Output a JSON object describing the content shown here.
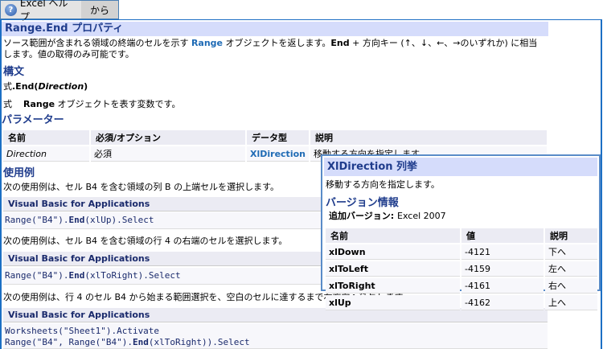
{
  "toolbar": {
    "help_label": "Excel ヘルプ",
    "from_label": "から"
  },
  "title": "Range.End プロパティ",
  "desc": {
    "l1a": "ソース範囲が含まれる領域の終端のセルを示す ",
    "l1link": "Range",
    "l1b": " オブジェクトを返します。",
    "l1bold": "End",
    "l1c": " + 方向キー (↑、↓、←、→のいずれか) に相当",
    "l2": "します。値の取得のみ可能です。"
  },
  "syntax": {
    "heading": "構文",
    "expr_prefix": "式",
    "expr_main": ".End(",
    "expr_param": "Direction",
    "expr_close": ")",
    "expr_label": "式",
    "expr_obj": "Range",
    "expr_desc": " オブジェクトを表す変数です。"
  },
  "params": {
    "heading": "パラメーター",
    "headers": [
      "名前",
      "必須/オプション",
      "データ型",
      "説明"
    ],
    "rows": [
      {
        "name": "Direction",
        "req": "必須",
        "type": "XlDirection",
        "desc": "移動する方向を指定します。"
      }
    ]
  },
  "examples": {
    "heading": "使用例",
    "items": [
      {
        "text": "次の使用例は、セル B4 を含む領域の列 B の上端セルを選択します。",
        "lang": "Visual Basic for Applications",
        "code": [
          [
            "Range(\"B4\").",
            "End",
            "(xlUp).Select"
          ]
        ]
      },
      {
        "text": "次の使用例は、セル B4 を含む領域の行 4 の右端のセルを選択します。",
        "lang": "Visual Basic for Applications",
        "code": [
          [
            "Range(\"B4\").",
            "End",
            "(xlToRight).Select"
          ]
        ]
      },
      {
        "text": "次の使用例は、行 4 のセル B4 から始まる範囲選択を、空白のセルに達するまで右方向へ延長します。",
        "lang": "Visual Basic for Applications",
        "code": [
          [
            "Worksheets(\"Sheet1\").Activate",
            "",
            ""
          ],
          [
            "Range(\"B4\", Range(\"B4\").",
            "End",
            "(xlToRight)).Select"
          ]
        ]
      }
    ]
  },
  "popup": {
    "title": "XlDirection 列挙",
    "desc": "移動する方向を指定します。",
    "version_heading": "バージョン情報",
    "version_label": "追加バージョン: ",
    "version_value": "Excel 2007",
    "headers": [
      "名前",
      "値",
      "説明"
    ],
    "rows": [
      [
        "xlDown",
        "-4121",
        "下へ"
      ],
      [
        "xlToLeft",
        "-4159",
        "左へ"
      ],
      [
        "xlToRight",
        "-4161",
        "右へ"
      ],
      [
        "xlUp",
        "-4162",
        "上へ"
      ]
    ]
  }
}
